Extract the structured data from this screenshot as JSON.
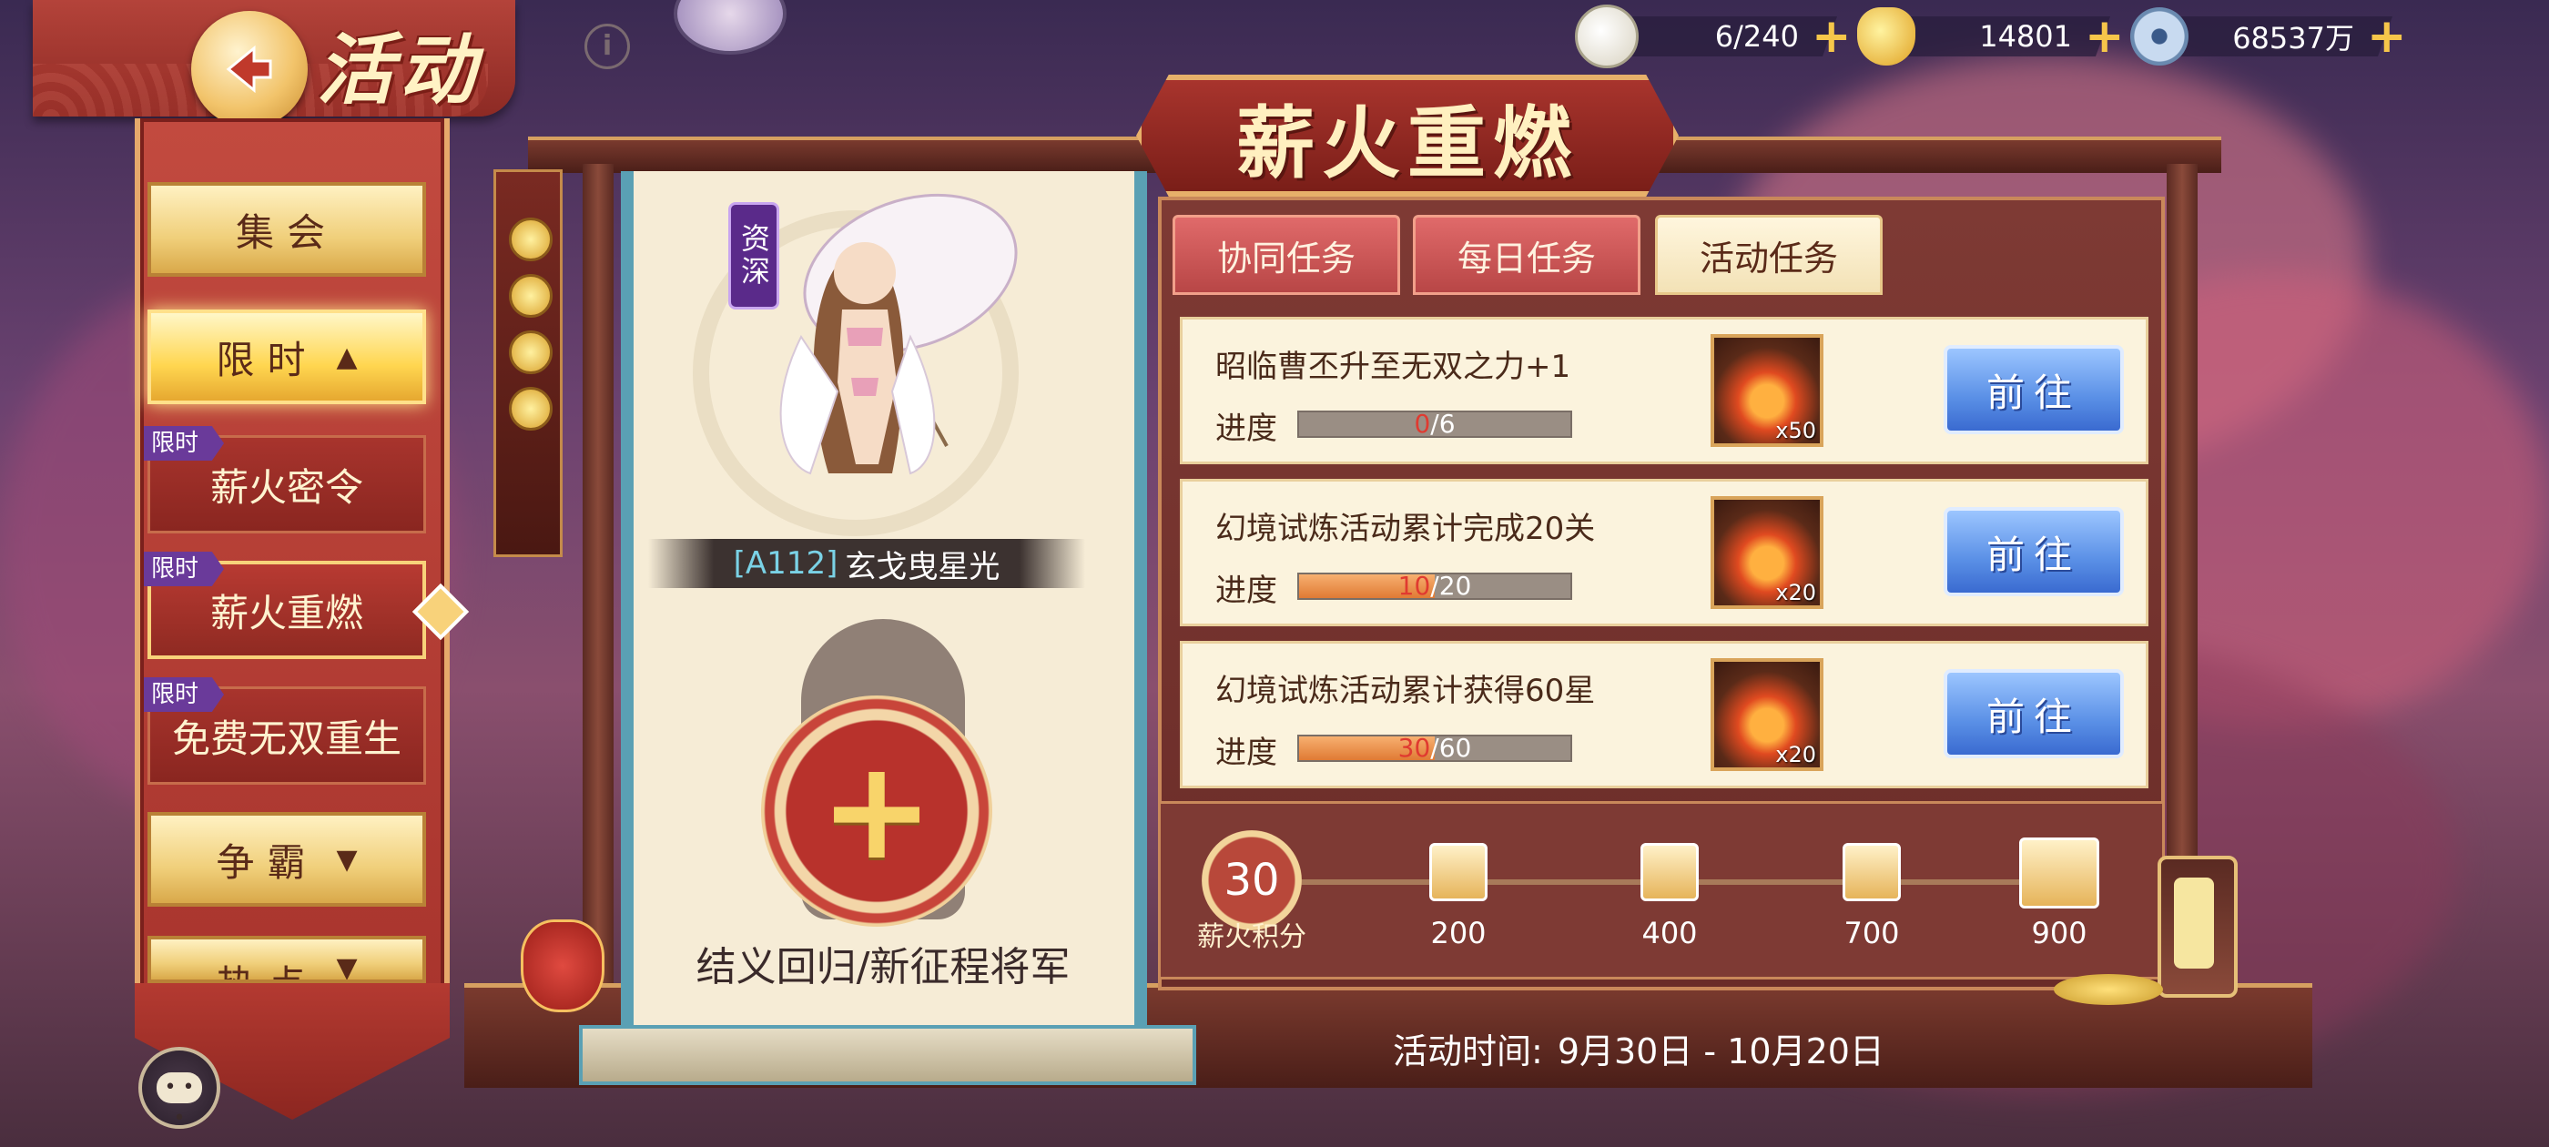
{
  "header": {
    "title": "活动",
    "back_icon": "back-arrow-icon",
    "info_icon": "info-icon"
  },
  "currencies": [
    {
      "icon": "steamed-bun-icon",
      "value": "6/240",
      "color": "#e8e4d0"
    },
    {
      "icon": "gold-ingot-icon",
      "value": "14801",
      "color": "#f6c64a"
    },
    {
      "icon": "coin-icon",
      "value": "68537万",
      "color": "#a9c4e6"
    }
  ],
  "sidebar": {
    "gathering": "集会",
    "limited": "限时",
    "sub_items": [
      {
        "tag": "限时",
        "label": "薪火密令"
      },
      {
        "tag": "限时",
        "label": "薪火重燃"
      },
      {
        "tag": "限时",
        "label": "免费无双重生"
      }
    ],
    "compete": "争霸",
    "hot": "热点"
  },
  "event": {
    "title": "薪火重燃",
    "hero": {
      "badge": "资深",
      "code": "[A112]",
      "name": "玄戈曳星光"
    },
    "recruit_label": "结义回归/新征程将军",
    "tabs": [
      "协同任务",
      "每日任务",
      "活动任务"
    ],
    "active_tab": "活动任务",
    "tasks": [
      {
        "title": "昭临曹丕升至无双之力+1",
        "progress_label": "进度",
        "current": "0",
        "total": "/6",
        "fraction": 0.0,
        "reward_count": "x50",
        "go_label": "前往"
      },
      {
        "title": "幻境试炼活动累计完成20关",
        "progress_label": "进度",
        "current": "10",
        "total": "/20",
        "fraction": 0.5,
        "reward_count": "x20",
        "go_label": "前往"
      },
      {
        "title": "幻境试炼活动累计获得60星",
        "progress_label": "进度",
        "current": "30",
        "total": "/60",
        "fraction": 0.5,
        "reward_count": "x20",
        "go_label": "前往"
      }
    ],
    "points": {
      "value": "30",
      "label": "薪火积分",
      "milestones": [
        "200",
        "400",
        "700",
        "900"
      ]
    },
    "time_label": "活动时间:",
    "time_range": "9月30日 - 10月20日"
  },
  "colors": {
    "accent_red": "#a8342d",
    "gold": "#f0cf7a",
    "blue_button": "#5a90e6",
    "progress_fill": "#e07a34"
  }
}
